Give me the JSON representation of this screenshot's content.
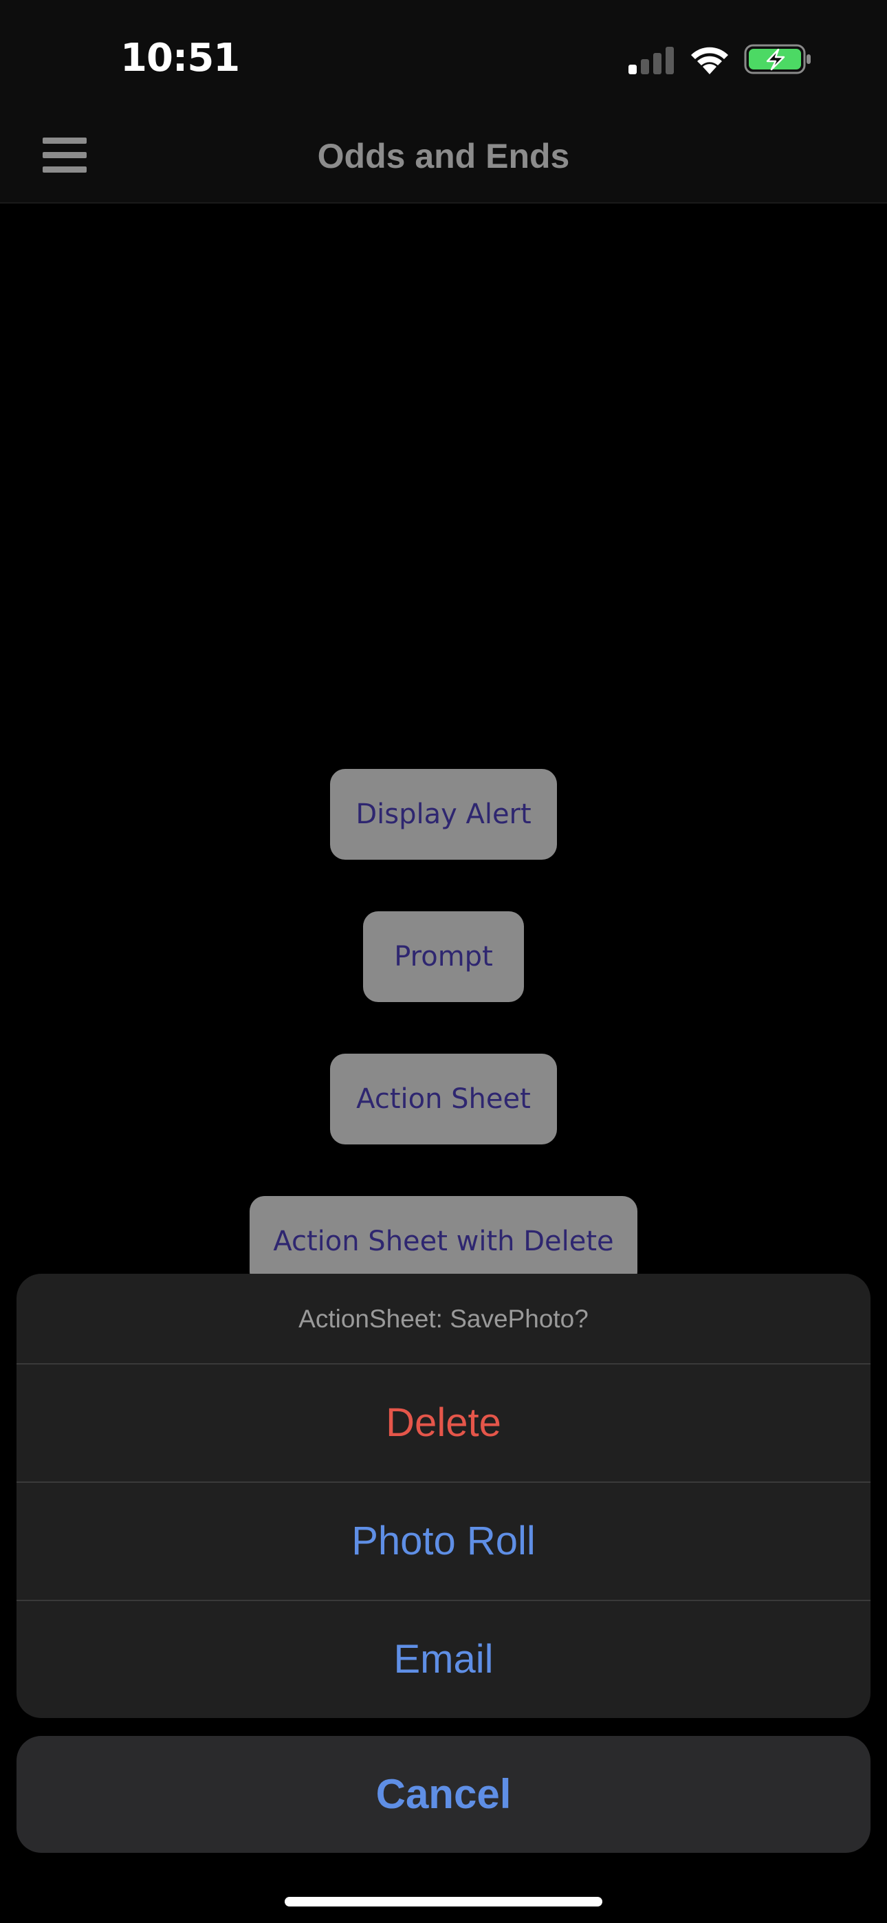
{
  "status_bar": {
    "time": "10:51",
    "icons": [
      "cellular-signal-icon",
      "wifi-icon",
      "battery-charging-icon"
    ]
  },
  "nav_bar": {
    "title": "Odds and Ends",
    "menu_icon": "hamburger-menu-icon"
  },
  "page_buttons": [
    {
      "label": "Display Alert"
    },
    {
      "label": "Prompt"
    },
    {
      "label": "Action Sheet"
    },
    {
      "label": "Action Sheet with Delete"
    }
  ],
  "action_sheet": {
    "title": "ActionSheet: SavePhoto?",
    "options": [
      {
        "label": "Delete",
        "style": "destructive"
      },
      {
        "label": "Photo Roll",
        "style": "default"
      },
      {
        "label": "Email",
        "style": "default"
      }
    ],
    "cancel_label": "Cancel"
  },
  "colors": {
    "destructive": "#e5564a",
    "accent": "#5f8fe6",
    "button_bg": "#8a8a8a",
    "button_text": "#2e2670",
    "battery_fill": "#4cd964"
  }
}
